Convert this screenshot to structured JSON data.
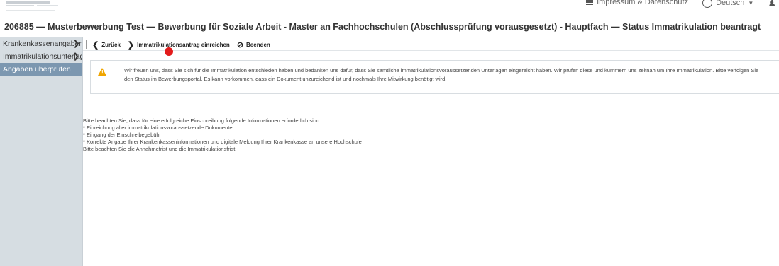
{
  "header": {
    "nav": {
      "impressum_label": "Impressum & Datenschutz",
      "language_label": "Deutsch"
    }
  },
  "page_title": "206885 — Musterbewerbung Test — Bewerbung für Soziale Arbeit - Master an Fachhochschulen (Abschlussprüfung vorausgesetzt) - Hauptfach — Status Immatrikulation beantragt",
  "sidebar": {
    "items": [
      {
        "label": "Krankenkassenangaben"
      },
      {
        "label": "Immatrikulationsunterlagen"
      },
      {
        "label": "Angaben überprüfen"
      }
    ]
  },
  "toolbar": {
    "back_label": "Zurück",
    "submit_label": "Immatrikulationsantrag einreichen",
    "end_label": "Beenden"
  },
  "alert": {
    "line1": "Wir freuen uns, dass Sie sich für die Immatrikulation entschieden haben und bedanken uns dafür, dass Sie sämtliche immatrikulationsvoraussetzenden Unterlagen eingereicht haben. Wir prüfen diese und kümmern uns zeitnah um Ihre Immatrikulation. Bitte verfolgen Sie",
    "line2": "den Status im Bewerbungsportal. Es kann vorkommen, dass ein Dokument unzureichend ist und nochmals Ihre Mitwirkung benötigt wird."
  },
  "info": {
    "intro": "Bitte beachten Sie, dass für eine erfolgreiche Einschreibung folgende Informationen erforderlich sind:",
    "bullets": [
      "* Einreichung aller immatrikulationsvoraussetzende Dokumente",
      "* Eingang der Einschreibegebühr",
      "* Korrekte Angabe Ihrer Krankenkasseninformationen und digitale Meldung Ihrer Krankenkasse an unsere Hochschule"
    ],
    "outro": "Bitte beachten Sie die Annahmefrist und die Immatrikulationsfrist."
  },
  "colors": {
    "sidebar_bg": "#d6dde2",
    "sidebar_active": "#7c97b0",
    "warning": "#f0a500",
    "marker": "#e31b1b"
  }
}
